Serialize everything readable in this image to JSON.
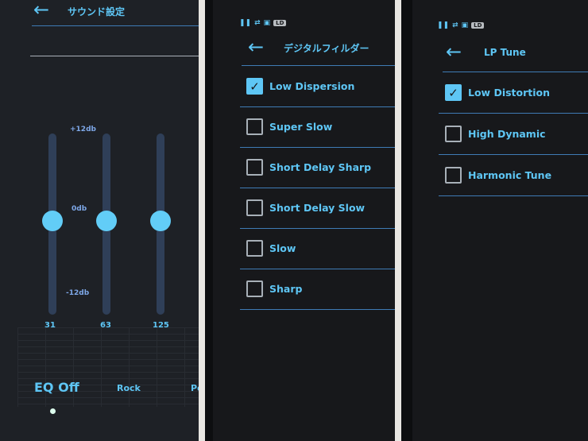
{
  "sound_settings": {
    "title": "サウンド設定",
    "db_labels": [
      "+12db",
      "0db",
      "-12db"
    ],
    "bands": [
      {
        "freq": "31",
        "gain_db": 0
      },
      {
        "freq": "63",
        "gain_db": 0
      },
      {
        "freq": "125",
        "gain_db": 0
      }
    ],
    "presets": [
      "EQ Off",
      "Rock",
      "Po"
    ],
    "selected_preset": "EQ Off"
  },
  "digital_filter": {
    "title": "デジタルフィルダー",
    "status_badge": "LD",
    "items": [
      {
        "label": "Low Dispersion",
        "checked": true
      },
      {
        "label": "Super Slow",
        "checked": false
      },
      {
        "label": "Short Delay Sharp",
        "checked": false
      },
      {
        "label": "Short Delay Slow",
        "checked": false
      },
      {
        "label": "Slow",
        "checked": false
      },
      {
        "label": "Sharp",
        "checked": false
      }
    ]
  },
  "lp_tune": {
    "title": "LP Tune",
    "status_badge": "LD",
    "items": [
      {
        "label": "Low Distortion",
        "checked": true
      },
      {
        "label": "High Dynamic",
        "checked": false
      },
      {
        "label": "Harmonic Tune",
        "checked": false
      }
    ]
  },
  "colors": {
    "accent": "#5ec6f5",
    "background": "#17181b"
  }
}
